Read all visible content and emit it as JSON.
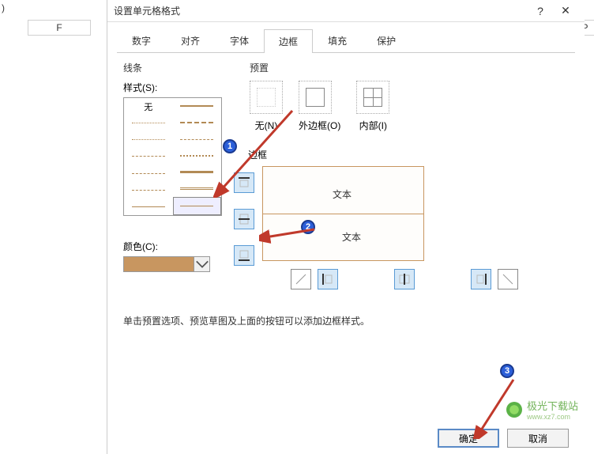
{
  "bg": {
    "colF": "F",
    "colP": "P",
    "paren": ")"
  },
  "dialog": {
    "title": "设置单元格格式",
    "help": "?",
    "close": "✕",
    "tabs": [
      "数字",
      "对齐",
      "字体",
      "边框",
      "填充",
      "保护"
    ],
    "activeTab": 3,
    "line": {
      "section": "线条",
      "styleLabel": "样式(S):",
      "none": "无",
      "colorLabel": "颜色(C):",
      "colorHex": "#c89660"
    },
    "preset": {
      "section": "预置",
      "items": [
        "无(N)",
        "外边框(O)",
        "内部(I)"
      ]
    },
    "border": {
      "section": "边框",
      "previewText": "文本"
    },
    "hint": "单击预置选项、预览草图及上面的按钮可以添加边框样式。",
    "buttons": {
      "ok": "确定",
      "cancel": "取消"
    }
  },
  "markers": {
    "m1": "1",
    "m2": "2",
    "m3": "3"
  },
  "watermark": {
    "name": "极光下载站",
    "url": "www.xz7.com"
  }
}
